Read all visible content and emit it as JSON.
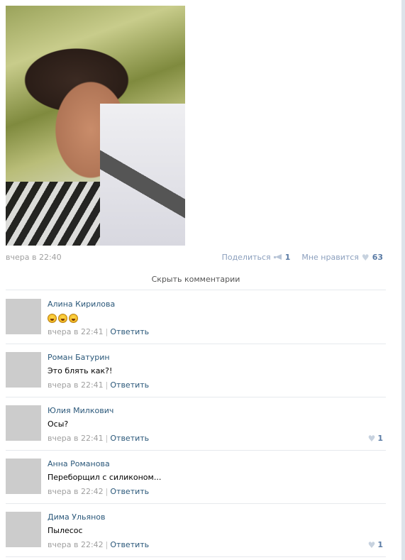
{
  "post": {
    "time": "вчера в 22:40",
    "share_label": "Поделиться",
    "share_count": "1",
    "like_label": "Мне нравится",
    "like_count": "63"
  },
  "hide_comments_label": "Скрыть комментарии",
  "reply_label": "Ответить",
  "comments": [
    {
      "author": "Алина Кирилова",
      "text": "",
      "emoji_count": 3,
      "time": "вчера в 22:41",
      "likes": ""
    },
    {
      "author": "Роман Батурин",
      "text": "Это блять как?!",
      "time": "вчера в 22:41",
      "likes": ""
    },
    {
      "author": "Юлия Милкович",
      "text": "Осы?",
      "time": "вчера в 22:41",
      "likes": "1"
    },
    {
      "author": "Анна Романова",
      "text": "Переборщил с силиконом...",
      "time": "вчера в 22:42",
      "likes": ""
    },
    {
      "author": "Дима Ульянов",
      "text": "Пылесос",
      "time": "вчера в 22:42",
      "likes": "1"
    }
  ]
}
